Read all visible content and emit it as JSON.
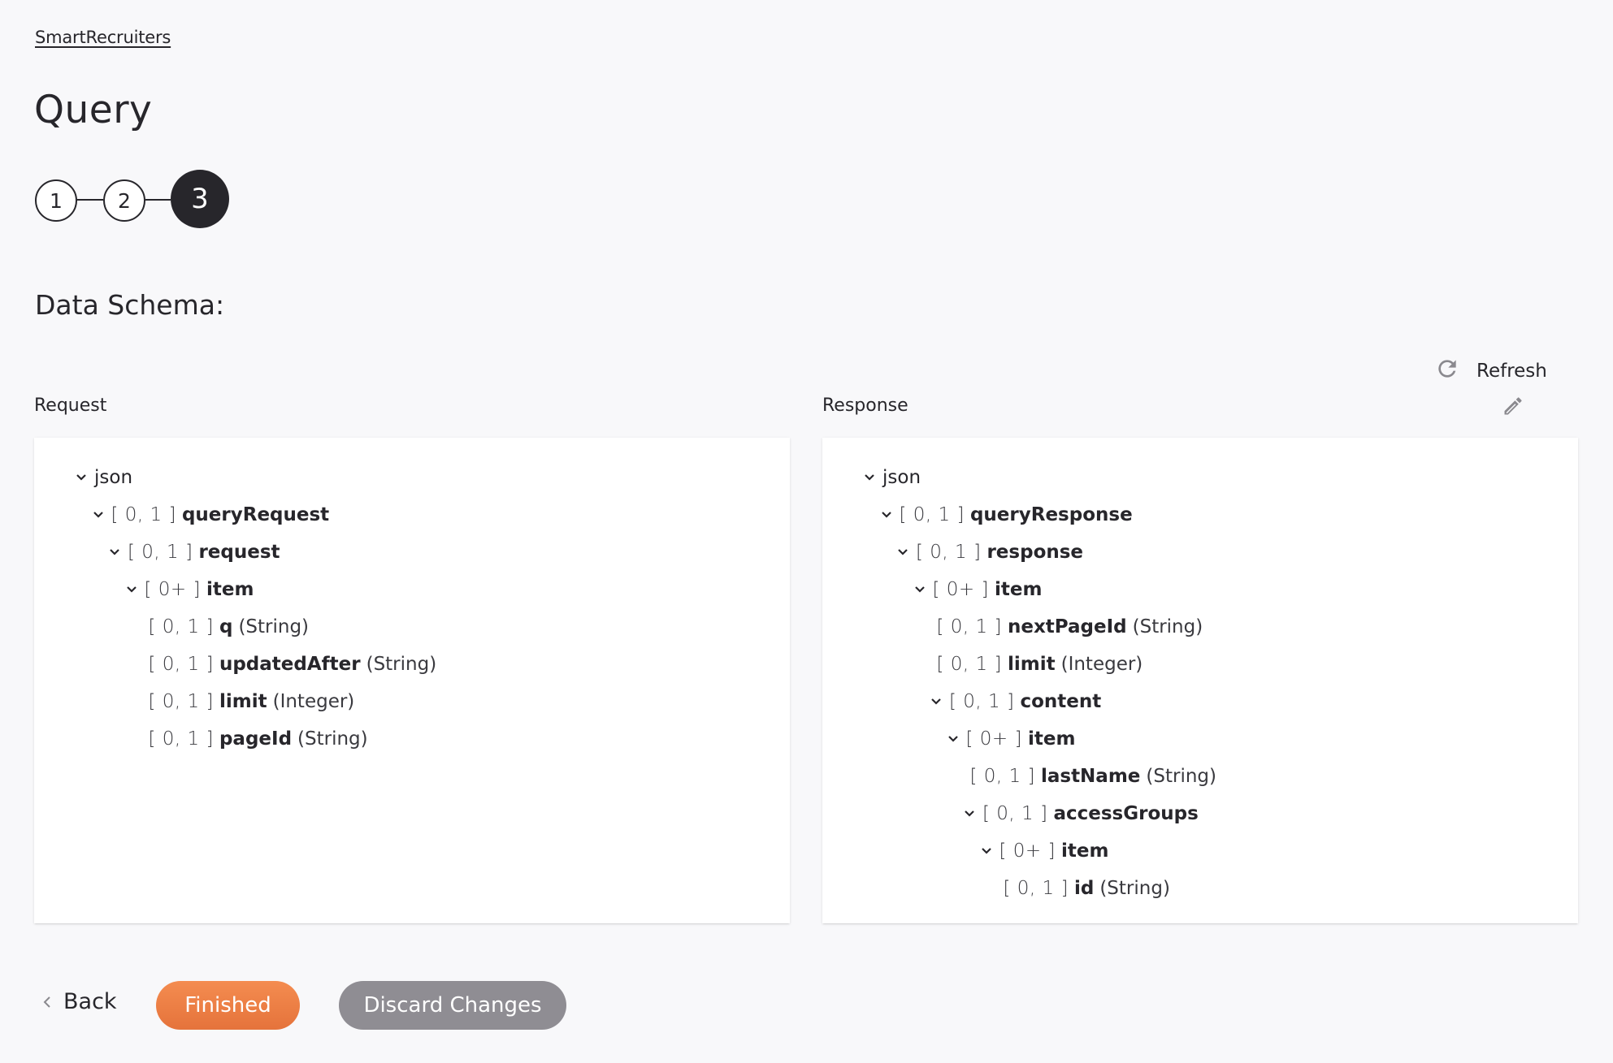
{
  "breadcrumb": "SmartRecruiters",
  "title": "Query",
  "stepper": {
    "steps": [
      {
        "label": "1",
        "state": "complete"
      },
      {
        "label": "2",
        "state": "complete"
      },
      {
        "label": "3",
        "state": "current"
      }
    ]
  },
  "section_title": "Data Schema:",
  "refresh_label": "Refresh",
  "icons": {
    "refresh": "refresh-icon",
    "edit": "pencil-icon",
    "expand": "chevron-down-icon",
    "back": "chevron-left-icon"
  },
  "colors": {
    "background": "#f8f8fa",
    "text": "#27262b",
    "finished_button": "#ee7f45",
    "discard_button": "#8f8d93",
    "icon_gray": "#8a898e"
  },
  "request": {
    "label": "Request",
    "tree": [
      {
        "level": 0,
        "expandable": true,
        "cardinality": "",
        "name": "json",
        "type": "",
        "plain": true
      },
      {
        "level": 1,
        "expandable": true,
        "cardinality": "[ 0, 1 ]",
        "name": "queryRequest",
        "type": ""
      },
      {
        "level": 2,
        "expandable": true,
        "cardinality": "[ 0, 1 ]",
        "name": "request",
        "type": ""
      },
      {
        "level": 3,
        "expandable": true,
        "cardinality": "[ 0+ ]",
        "name": "item",
        "type": ""
      },
      {
        "level": 4,
        "expandable": false,
        "cardinality": "[ 0, 1 ]",
        "name": "q",
        "type": "(String)"
      },
      {
        "level": 4,
        "expandable": false,
        "cardinality": "[ 0, 1 ]",
        "name": "updatedAfter",
        "type": "(String)"
      },
      {
        "level": 4,
        "expandable": false,
        "cardinality": "[ 0, 1 ]",
        "name": "limit",
        "type": "(Integer)"
      },
      {
        "level": 4,
        "expandable": false,
        "cardinality": "[ 0, 1 ]",
        "name": "pageId",
        "type": "(String)"
      }
    ]
  },
  "response": {
    "label": "Response",
    "tree": [
      {
        "level": 0,
        "expandable": true,
        "cardinality": "",
        "name": "json",
        "type": "",
        "plain": true
      },
      {
        "level": 1,
        "expandable": true,
        "cardinality": "[ 0, 1 ]",
        "name": "queryResponse",
        "type": ""
      },
      {
        "level": 2,
        "expandable": true,
        "cardinality": "[ 0, 1 ]",
        "name": "response",
        "type": ""
      },
      {
        "level": 3,
        "expandable": true,
        "cardinality": "[ 0+ ]",
        "name": "item",
        "type": ""
      },
      {
        "level": 4,
        "expandable": false,
        "cardinality": "[ 0, 1 ]",
        "name": "nextPageId",
        "type": "(String)"
      },
      {
        "level": 4,
        "expandable": false,
        "cardinality": "[ 0, 1 ]",
        "name": "limit",
        "type": "(Integer)"
      },
      {
        "level": 4,
        "expandable": true,
        "cardinality": "[ 0, 1 ]",
        "name": "content",
        "type": ""
      },
      {
        "level": 5,
        "expandable": true,
        "cardinality": "[ 0+ ]",
        "name": "item",
        "type": ""
      },
      {
        "level": 6,
        "expandable": false,
        "cardinality": "[ 0, 1 ]",
        "name": "lastName",
        "type": "(String)"
      },
      {
        "level": 6,
        "expandable": true,
        "cardinality": "[ 0, 1 ]",
        "name": "accessGroups",
        "type": ""
      },
      {
        "level": 7,
        "expandable": true,
        "cardinality": "[ 0+ ]",
        "name": "item",
        "type": ""
      },
      {
        "level": 8,
        "expandable": false,
        "cardinality": "[ 0, 1 ]",
        "name": "id",
        "type": "(String)"
      }
    ]
  },
  "footer": {
    "back_label": "Back",
    "finished_label": "Finished",
    "discard_label": "Discard Changes"
  }
}
